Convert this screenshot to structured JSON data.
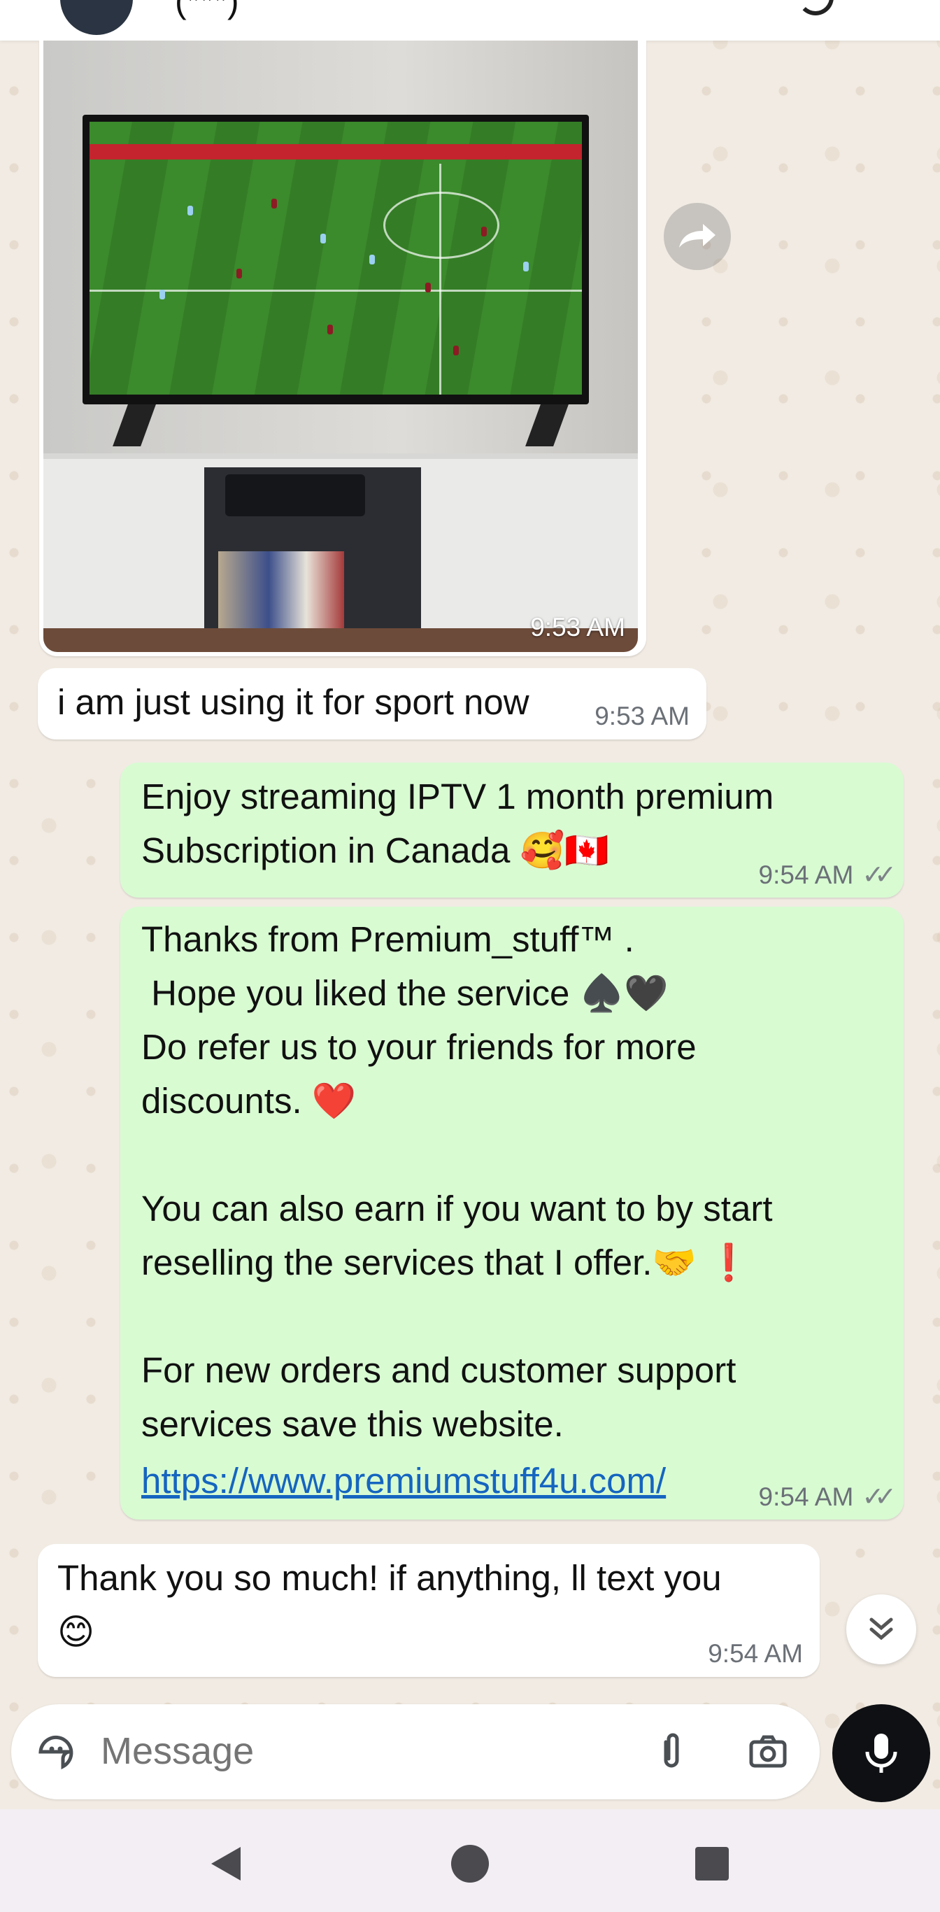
{
  "header": {
    "title": "(***)"
  },
  "messages": [
    {
      "type": "image",
      "direction": "incoming",
      "time": "9:53 AM"
    },
    {
      "type": "text",
      "direction": "incoming",
      "text": "i am just using it for sport now",
      "time": "9:53 AM"
    },
    {
      "type": "text",
      "direction": "outgoing",
      "text": "Enjoy streaming IPTV 1 month premium\nSubscription in Canada 🥰🇨🇦",
      "time": "9:54 AM"
    },
    {
      "type": "text",
      "direction": "outgoing",
      "text": "Thanks from Premium_stuff™ .\n Hope you liked the service ♠️🖤\nDo refer us to your friends for more\ndiscounts. ❤️\n\nYou can also earn if you want to by start\nreselling the services that I offer.🤝 ❗\n\nFor new orders and customer support\nservices save this website.",
      "link": "https://www.premiumstuff4u.com/",
      "time": "9:54 AM"
    },
    {
      "type": "text",
      "direction": "incoming",
      "text": "Thank you so much! if anything, ll text you\n😊",
      "time": "9:54 AM"
    }
  ],
  "composer": {
    "placeholder": "Message"
  },
  "colors": {
    "outgoing_bubble": "#d8fbd2",
    "incoming_bubble": "#ffffff",
    "mic_button": "#0f1013",
    "link": "#1565c0"
  },
  "icons": {
    "forward": "forward-icon",
    "scroll_down": "double-chevron-down-icon",
    "sticker": "sticker-icon",
    "attach": "paperclip-icon",
    "camera": "camera-icon",
    "mic": "mic-icon",
    "read_receipt": "double-check-icon",
    "nav_back": "back-triangle-icon",
    "nav_home": "home-circle-icon",
    "nav_recents": "recents-square-icon"
  }
}
